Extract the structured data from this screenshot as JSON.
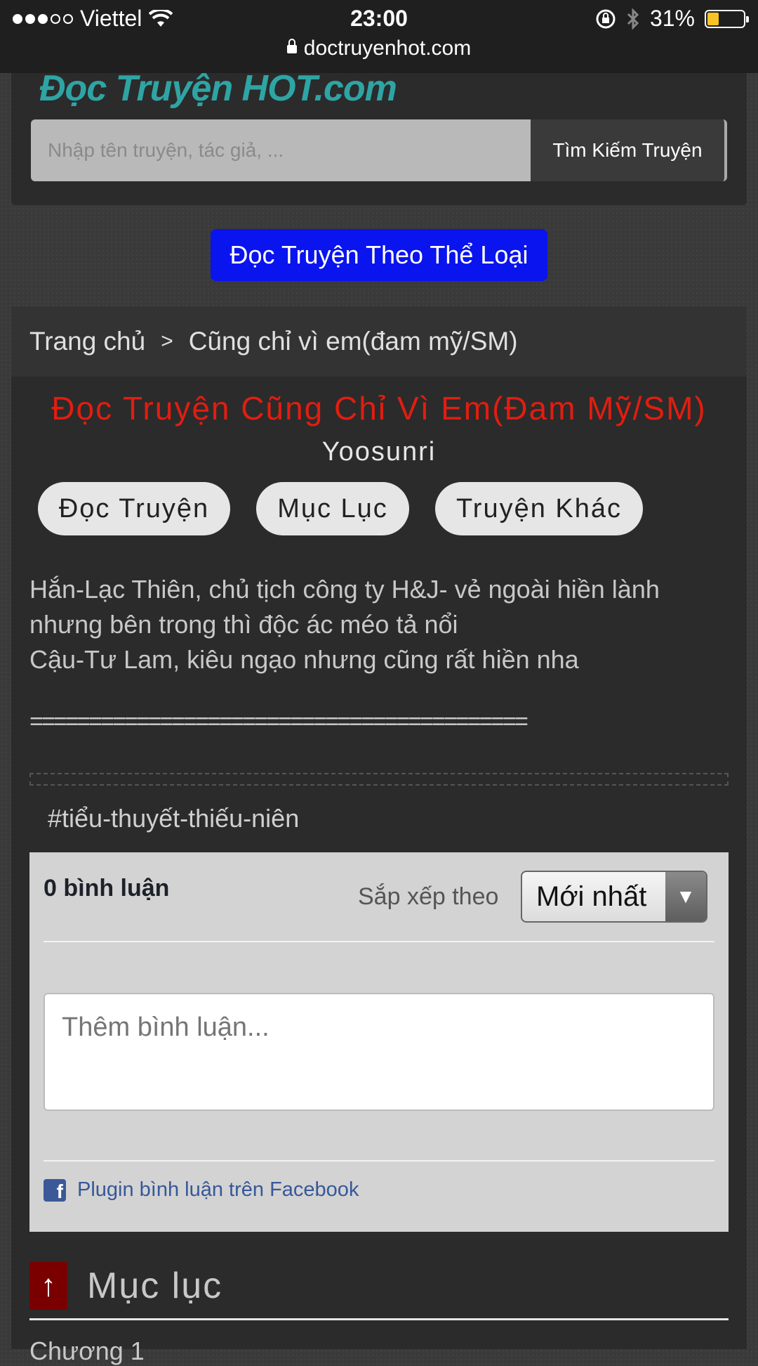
{
  "status_bar": {
    "carrier": "Viettel",
    "time": "23:00",
    "battery": "31%",
    "battery_level": 0.31,
    "url": "doctruyenhot.com"
  },
  "header": {
    "logo_text": "Đọc Truyện HOT.com",
    "search_placeholder": "Nhập tên truyện, tác giả, ...",
    "search_button": "Tìm Kiếm Truyện"
  },
  "genre_button": "Đọc Truyện Theo Thể Loại",
  "breadcrumb": {
    "home": "Trang chủ",
    "separator": ">",
    "current": "Cũng chỉ vì em(đam mỹ/SM)"
  },
  "story": {
    "title": "Đọc Truyện Cũng Chỉ Vì Em(Đam Mỹ/SM)",
    "author": "Yoosunri",
    "buttons": [
      "Đọc Truyện",
      "Mục Lục",
      "Truyện Khác"
    ],
    "description": [
      "Hắn-Lạc Thiên, chủ tịch công ty H&J- vẻ ngoài hiền lành",
      "nhưng bên trong thì độc ác méo tả nổi",
      "Cậu-Tư Lam, kiêu ngạo nhưng cũng rất hiền nha"
    ],
    "separator_line": "==========================================",
    "hashtag": "#tiểu-thuyết-thiếu-niên"
  },
  "comments": {
    "count_label": "0 bình luận",
    "sort_label": "Sắp xếp theo",
    "sort_value": "Mới nhất",
    "input_placeholder": "Thêm bình luận...",
    "plugin_label": "Plugin bình luận trên Facebook"
  },
  "toc": {
    "arrow": "↑",
    "title": "Mục lục",
    "first_item": "Chương 1"
  },
  "colors": {
    "title_red": "#e11d10",
    "genre_blue": "#0a14ee",
    "toc_arrow_bg": "#7a0000",
    "fb_blue": "#3b5998"
  }
}
